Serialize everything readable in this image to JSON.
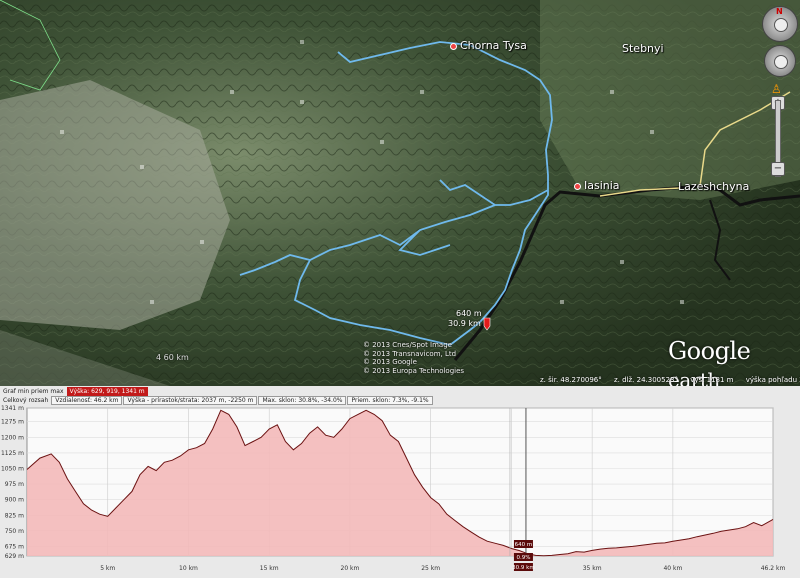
{
  "map": {
    "places": [
      {
        "name": "Chorna Tysa",
        "x": 450,
        "y": 47,
        "dot": true
      },
      {
        "name": "Stebnyi",
        "x": 622,
        "y": 50,
        "dot": false
      },
      {
        "name": "Iasinia",
        "x": 574,
        "y": 187,
        "dot": true
      },
      {
        "name": "Lazeshchyna",
        "x": 678,
        "y": 188,
        "dot": false
      }
    ],
    "copyright": [
      "© 2013 Cnes/Spot Image",
      "© 2013 Transnavicom, Ltd",
      "© 2013 Google",
      "© 2013 Europa Technologies"
    ],
    "logo_main": "Google",
    "logo_sub": "earth",
    "elev_label": "4 60 km",
    "marker_alt": "640 m",
    "marker_dist": "30.9 km",
    "status": {
      "lat": "z. šir.  48.270096°",
      "lon": "z. dlž.  24.300523°",
      "alt": "vyš.  1181 m",
      "eye": "výška pohľadu  20.53 km"
    },
    "colors": {
      "route": "#6fb9ec",
      "road": "#111111",
      "road2": "#e8d98a",
      "marker": "#e31b1b"
    }
  },
  "profile": {
    "row1": [
      "Graf  min  priem  max",
      "Výška: 629, 919, 1341 m"
    ],
    "row2": [
      "Celkový rozsah",
      "Vzdialenosť: 46.2 km",
      "Výška - prírastok/strata: 2037 m, -2250 m",
      "Max. sklon: 30.8%, -34.0%",
      "Priem. sklon: 7.3%, -9.1%"
    ],
    "cursor_alt": "640 m",
    "cursor_slope": "0.9%",
    "cursor_dist": "30.9 km"
  },
  "chart_data": {
    "type": "area",
    "title": "",
    "xlabel": "",
    "ylabel": "",
    "x_unit": "km",
    "y_unit": "m",
    "xlim": [
      0,
      46.2
    ],
    "ylim": [
      629,
      1341
    ],
    "y_ticks": [
      629,
      675,
      750,
      825,
      900,
      975,
      1050,
      1125,
      1200,
      1275,
      1341
    ],
    "y_tick_labels": [
      "629 m",
      "675 m",
      "750 m",
      "825 m",
      "900 m",
      "975 m",
      "1050 m",
      "1125 m",
      "1200 m",
      "1275 m",
      "1341 m"
    ],
    "x_ticks": [
      5,
      10,
      15,
      20,
      25,
      30,
      35,
      40,
      46.2
    ],
    "x_tick_labels": [
      "5 km",
      "10 km",
      "15 km",
      "20 km",
      "25 km",
      "",
      "35 km",
      "40 km",
      "46.2 km"
    ],
    "cursor_x": 30.9,
    "fill_color": "#f3b9b9",
    "line_color": "#6b1212",
    "series": [
      {
        "x": [
          0,
          0.8,
          1.5,
          2,
          2.5,
          3,
          3.5,
          4,
          4.5,
          5,
          5.5,
          6,
          6.5,
          7,
          7.5,
          8,
          8.5,
          9,
          9.5,
          10,
          10.5,
          11,
          11.5,
          12,
          12.5,
          13,
          13.5,
          14,
          14.5,
          15,
          15.5,
          16,
          16.5,
          17,
          17.5,
          18,
          18.5,
          19,
          19.5,
          20,
          20.5,
          21,
          21.5,
          22,
          22.5,
          23,
          23.5,
          24,
          24.5,
          25,
          25.5,
          26,
          26.5,
          27,
          27.5,
          28,
          28.5,
          29,
          29.5,
          30,
          30.5,
          31,
          31.5,
          32,
          32.5,
          33,
          33.5,
          34,
          34.5,
          35,
          35.5,
          36,
          36.5,
          37,
          37.5,
          38,
          38.5,
          39,
          39.5,
          40,
          40.5,
          41,
          41.5,
          42,
          42.5,
          43,
          43.5,
          44,
          44.5,
          45,
          45.5,
          46.2
        ],
        "y": [
          1045,
          1100,
          1120,
          1080,
          1000,
          940,
          880,
          850,
          830,
          820,
          860,
          900,
          940,
          1020,
          1060,
          1040,
          1080,
          1090,
          1110,
          1140,
          1150,
          1170,
          1240,
          1330,
          1310,
          1250,
          1160,
          1180,
          1200,
          1240,
          1260,
          1180,
          1140,
          1170,
          1220,
          1250,
          1210,
          1200,
          1240,
          1290,
          1310,
          1330,
          1310,
          1280,
          1210,
          1180,
          1100,
          1020,
          960,
          910,
          880,
          830,
          800,
          770,
          745,
          720,
          700,
          690,
          680,
          665,
          655,
          640,
          632,
          630,
          632,
          636,
          640,
          650,
          648,
          656,
          662,
          666,
          668,
          672,
          675,
          680,
          685,
          690,
          692,
          700,
          706,
          712,
          722,
          730,
          738,
          748,
          754,
          760,
          770,
          790,
          775,
          805
        ]
      }
    ]
  }
}
